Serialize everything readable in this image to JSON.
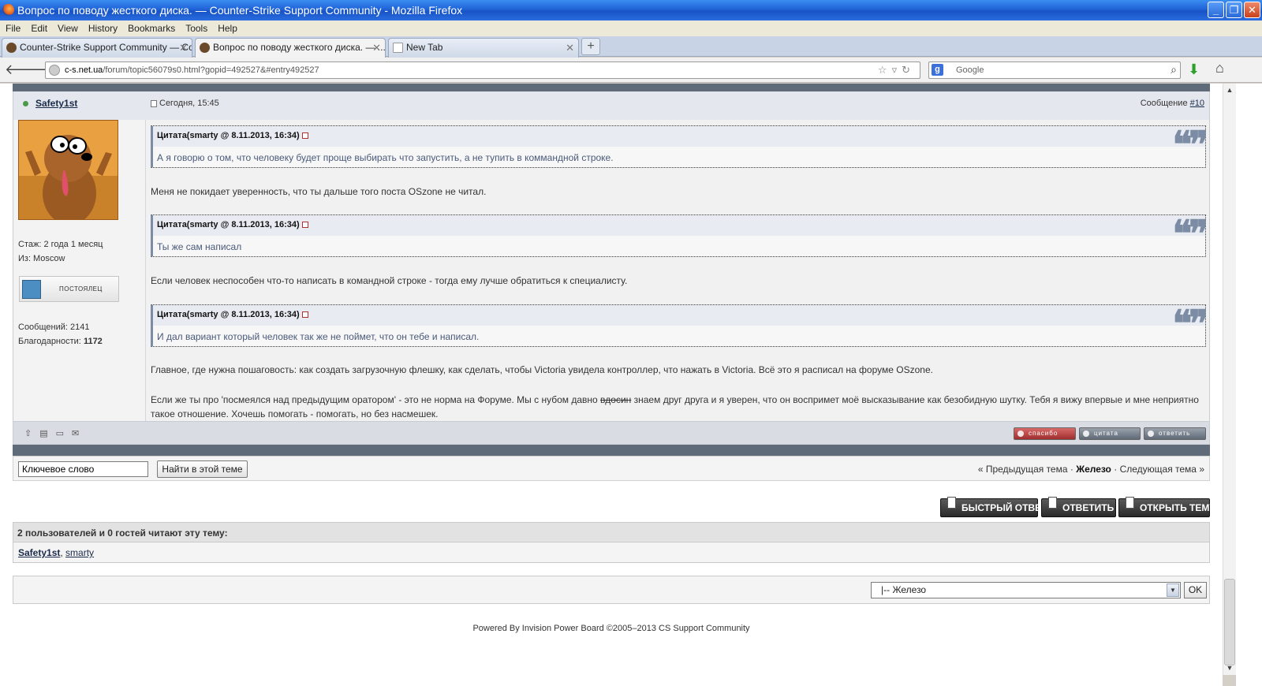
{
  "window": {
    "title": "Вопрос по поводу жесткого диска. — Counter-Strike Support Community - Mozilla Firefox"
  },
  "menu": [
    "File",
    "Edit",
    "View",
    "History",
    "Bookmarks",
    "Tools",
    "Help"
  ],
  "tabs": [
    {
      "label": "Counter-Strike Support Community — Co..."
    },
    {
      "label": "Вопрос по поводу жесткого диска. — ..."
    },
    {
      "label": "New Tab"
    }
  ],
  "address": {
    "host": "c-s.net.ua",
    "path": "/forum/topic56079s0.html?gopid=492527&#entry492527"
  },
  "search": {
    "placeholder": "Google"
  },
  "post": {
    "author": "Safety1st",
    "date": "Сегодня, 15:45",
    "number_label": "Сообщение",
    "number": "#10",
    "stats": {
      "tenure": "Стаж: 2 года 1 месяц",
      "from": "Из: Moscow",
      "rank": "ПОСТОЯЛЕЦ",
      "messages": "Сообщений: 2141",
      "thanks_label": "Благодарности:",
      "thanks_value": "1172"
    },
    "quotes": [
      {
        "header": "Цитата(smarty @ 8.11.2013, 16:34)",
        "text": "А я говорю о том, что человеку будет проще выбирать что запустить, а не тупить в коммандной строке."
      },
      {
        "header": "Цитата(smarty @ 8.11.2013, 16:34)",
        "text": "Ты же сам написал"
      },
      {
        "header": "Цитата(smarty @ 8.11.2013, 16:34)",
        "text": "И дал вариант который человек так же не поймет, что он тебе и написал."
      }
    ],
    "paragraphs": [
      "Меня не покидает уверенность, что ты дальше того поста OSzone не читал.",
      "Если человек неспособен что-то написать в командной строке - тогда ему лучше обратиться к специалисту.",
      "Главное, где нужна пошаговость: как создать загрузочную флешку, как сделать, чтобы Victoria увидела контроллер, что нажать в Victoria. Всё это я расписал на форуме OSzone."
    ],
    "last_paragraph": {
      "before": "Если же ты про 'посмеялся над предыдущим оратором' - это не норма на Форуме. Мы с нубом давно ",
      "struck": "вдосин",
      "after": " знаем друг друга и я уверен, что он воспримет моё высказывание как безобидную шутку. Тебя я вижу впервые и мне неприятно такое отношение. Хочешь помогать - помогать, но без насмешек."
    },
    "buttons": {
      "thanks": "спасибо",
      "quote": "цитата",
      "reply": "ответить"
    }
  },
  "topic_search": {
    "input_value": "Ключевое слово",
    "button": "Найти в этой теме",
    "prev": "« Предыдущая тема",
    "sep": "·",
    "forum": "Железо",
    "next": "Следующая тема »"
  },
  "action_buttons": {
    "fast_reply": "БЫСТРЫЙ ОТВЕТ",
    "reply": "ОТВЕТИТЬ",
    "new_topic": "ОТКРЫТЬ ТЕМУ"
  },
  "readers": {
    "header": "2 пользователей и 0 гостей читают эту тему:",
    "users": [
      "Safety1st",
      "smarty"
    ]
  },
  "jump": {
    "selected": "|-- Железо",
    "ok": "OK"
  },
  "footer": "Powered By Invision Power Board  ©2005–2013  CS Support Community"
}
